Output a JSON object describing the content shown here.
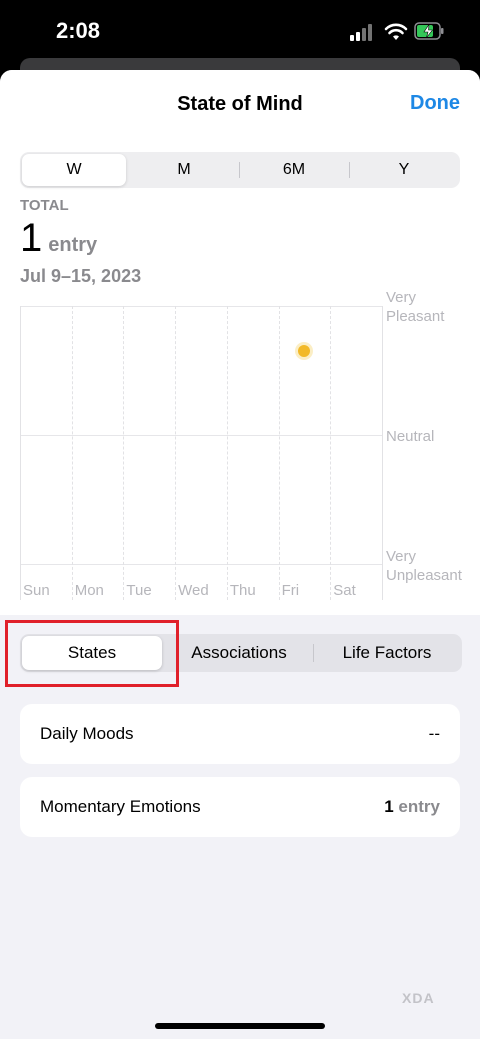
{
  "status_bar": {
    "time": "2:08"
  },
  "header": {
    "title": "State of Mind",
    "done_label": "Done"
  },
  "range_tabs": [
    {
      "label": "W",
      "selected": true
    },
    {
      "label": "M",
      "selected": false
    },
    {
      "label": "6M",
      "selected": false
    },
    {
      "label": "Y",
      "selected": false
    }
  ],
  "summary": {
    "total_label": "TOTAL",
    "count": "1",
    "count_unit": "entry",
    "date_range": "Jul 9–15, 2023"
  },
  "chart_data": {
    "type": "scatter",
    "categories": [
      "Sun",
      "Mon",
      "Tue",
      "Wed",
      "Thu",
      "Fri",
      "Sat"
    ],
    "y_labels": {
      "top_line1": "Very",
      "top_line2": "Pleasant",
      "middle": "Neutral",
      "bottom_line1": "Very",
      "bottom_line2": "Unpleasant"
    },
    "ylim": [
      -1,
      1
    ],
    "points": [
      {
        "x": "Fri",
        "y": 0.65,
        "color": "#f2b928"
      }
    ],
    "grid": true
  },
  "type_tabs": [
    {
      "label": "States",
      "selected": true
    },
    {
      "label": "Associations",
      "selected": false
    },
    {
      "label": "Life Factors",
      "selected": false
    }
  ],
  "rows": {
    "daily_moods": {
      "label": "Daily Moods",
      "value": "--"
    },
    "momentary_emotions": {
      "label": "Momentary Emotions",
      "value_num": "1",
      "value_unit": "entry"
    }
  },
  "watermark": "XDA",
  "colors": {
    "accent": "#1e88e5",
    "highlight": "#e0202a",
    "point": "#f2b928"
  }
}
